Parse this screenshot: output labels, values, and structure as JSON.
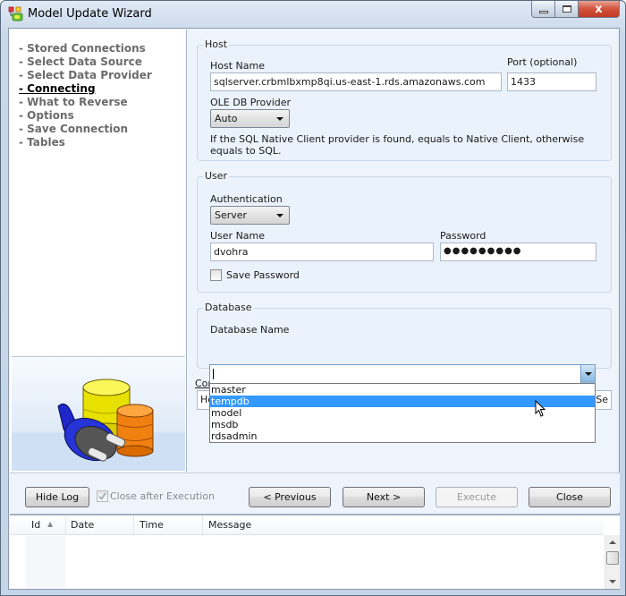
{
  "window": {
    "title": "Model Update Wizard",
    "icon": "model-wizard-icon",
    "caption_buttons": [
      "minimize",
      "maximize",
      "close"
    ],
    "close_glyph": "x"
  },
  "nav": {
    "items": [
      {
        "label": "- Stored Connections",
        "active": false
      },
      {
        "label": "- Select Data Source",
        "active": false
      },
      {
        "label": "- Select Data Provider",
        "active": false
      },
      {
        "label": "- Connecting",
        "active": true
      },
      {
        "label": "- What to Reverse",
        "active": false
      },
      {
        "label": "- Options",
        "active": false
      },
      {
        "label": "- Save Connection",
        "active": false
      },
      {
        "label": "- Tables",
        "active": false
      }
    ]
  },
  "host": {
    "group_title": "Host",
    "host_name_label": "Host Name",
    "host_name_value": "sqlserver.crbmlbxmp8qi.us-east-1.rds.amazonaws.com",
    "port_label": "Port (optional)",
    "port_value": "1433",
    "provider_label": "OLE DB Provider",
    "provider_value": "Auto",
    "provider_hint": "If the SQL Native Client provider is found, equals to Native Client, otherwise equals to SQL."
  },
  "user": {
    "group_title": "User",
    "auth_label": "Authentication",
    "auth_value": "Server",
    "username_label": "User Name",
    "username_value": "dvohra",
    "password_label": "Password",
    "password_value": "●●●●●●●●●",
    "save_password_label": "Save Password",
    "save_password_checked": false
  },
  "database": {
    "group_title": "Database",
    "db_name_label": "Database Name",
    "db_name_value": "",
    "options": [
      "master",
      "tempdb",
      "model",
      "msdb",
      "rdsadmin"
    ],
    "highlighted": "tempdb",
    "obscured_label_fragment": "Cor",
    "obscured_value_fragment": "Ho",
    "obscured_right_fragment": "Se"
  },
  "buttons": {
    "hide_log": "Hide Log",
    "close_after_execution": "Close after Execution",
    "close_after_execution_checked": true,
    "previous": "< Previous",
    "next": "Next >",
    "execute": "Execute",
    "close": "Close"
  },
  "log": {
    "columns": [
      "Id",
      "Date",
      "Time",
      "Message"
    ],
    "sort_indicator": "▲",
    "rows": []
  }
}
